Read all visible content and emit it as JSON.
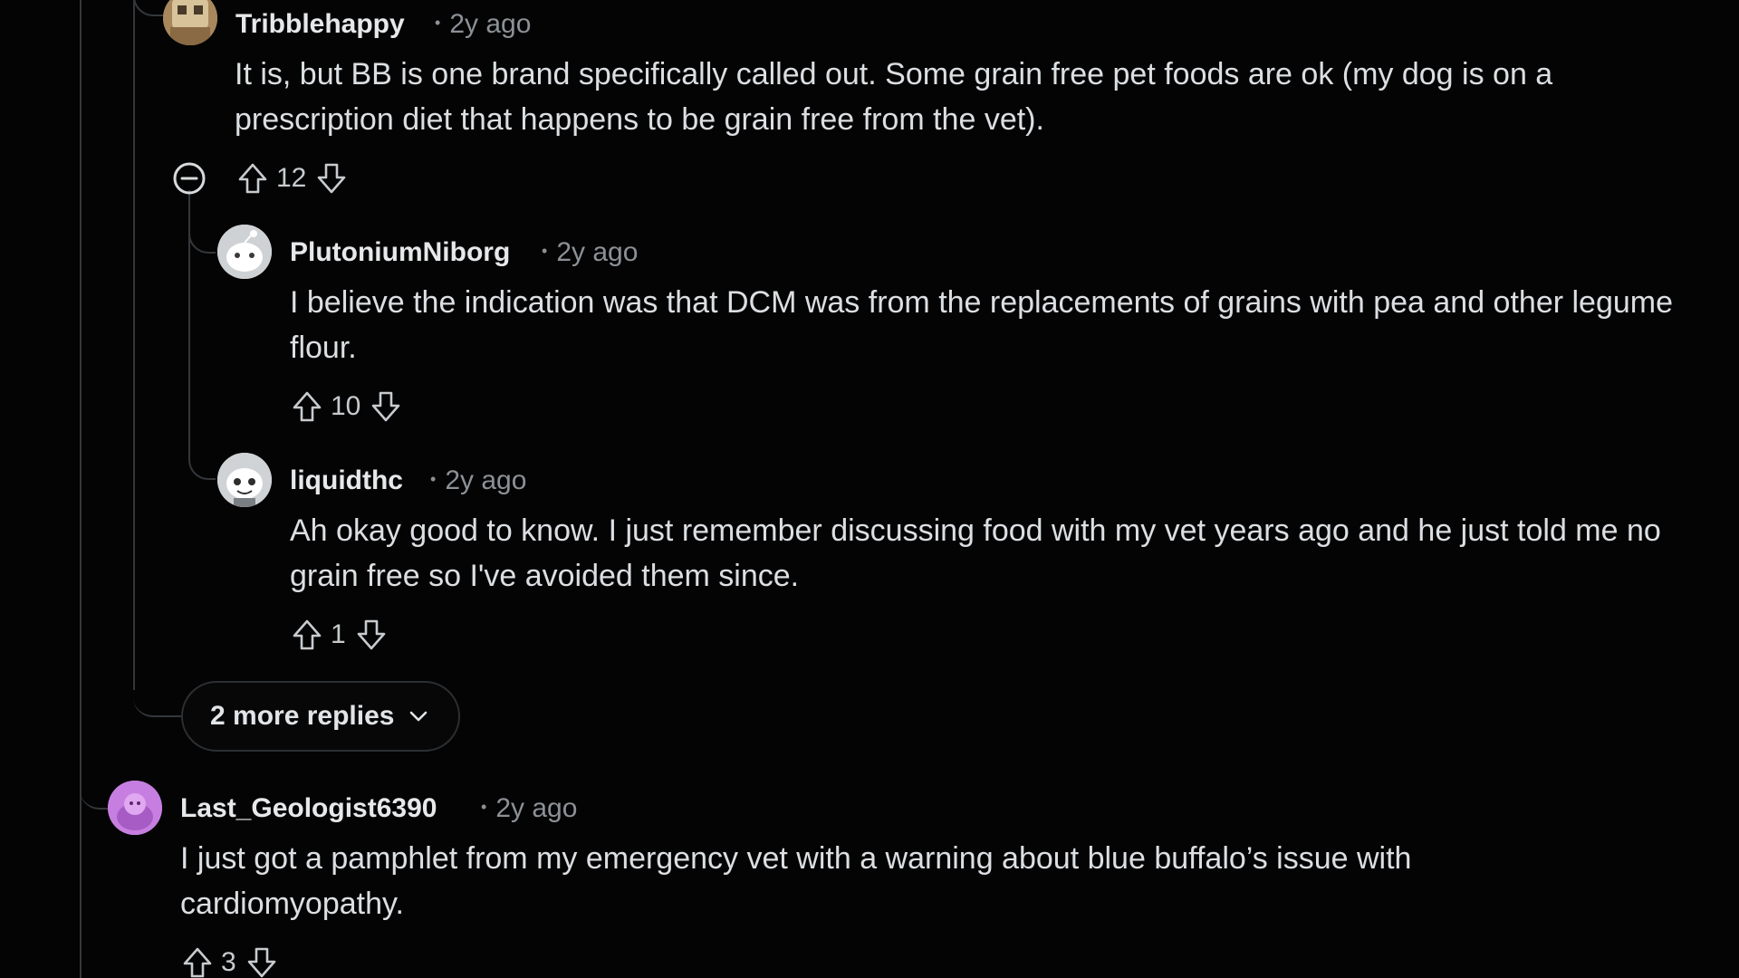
{
  "colors": {
    "background": "#040405",
    "thread_line": "#34373a",
    "username": "#e6e8ea",
    "meta": "#8c9196",
    "body": "#dcdfe2",
    "avatar_purple": "#c67fe0"
  },
  "comments": [
    {
      "username": "Tribblehappy",
      "time": "2y ago",
      "separator": "•",
      "body": "It is, but BB is one brand specifically called out. Some grain free pet foods are ok (my dog is on a prescription diet that happens to be grain free from the vet).",
      "score": "12",
      "avatar_icon": "tan-avatar-icon"
    },
    {
      "username": "PlutoniumNiborg",
      "time": "2y ago",
      "separator": "•",
      "body": "I believe the indication was that DCM was from the replacements of grains with pea and other legume flour.",
      "score": "10",
      "avatar_icon": "white-snoo-avatar-icon"
    },
    {
      "username": "liquidthc",
      "time": "2y ago",
      "separator": "•",
      "body": "Ah okay good to know. I just remember discussing food with my vet years ago and he just told me no grain free so I've avoided them since.",
      "score": "1",
      "avatar_icon": "white-snoo-avatar-icon"
    },
    {
      "username": "Last_Geologist6390",
      "time": "2y ago",
      "separator": "•",
      "body": "I just got a pamphlet from my emergency vet with a warning about blue buffalo’s issue with cardiomyopathy.",
      "score": "3",
      "avatar_icon": "purple-snoo-avatar-icon"
    }
  ],
  "more_replies": {
    "label": "2 more replies"
  },
  "icons": {
    "upvote": "upvote-arrow-icon",
    "downvote": "downvote-arrow-icon",
    "collapse": "collapse-minus-icon",
    "chevron": "chevron-down-icon"
  }
}
